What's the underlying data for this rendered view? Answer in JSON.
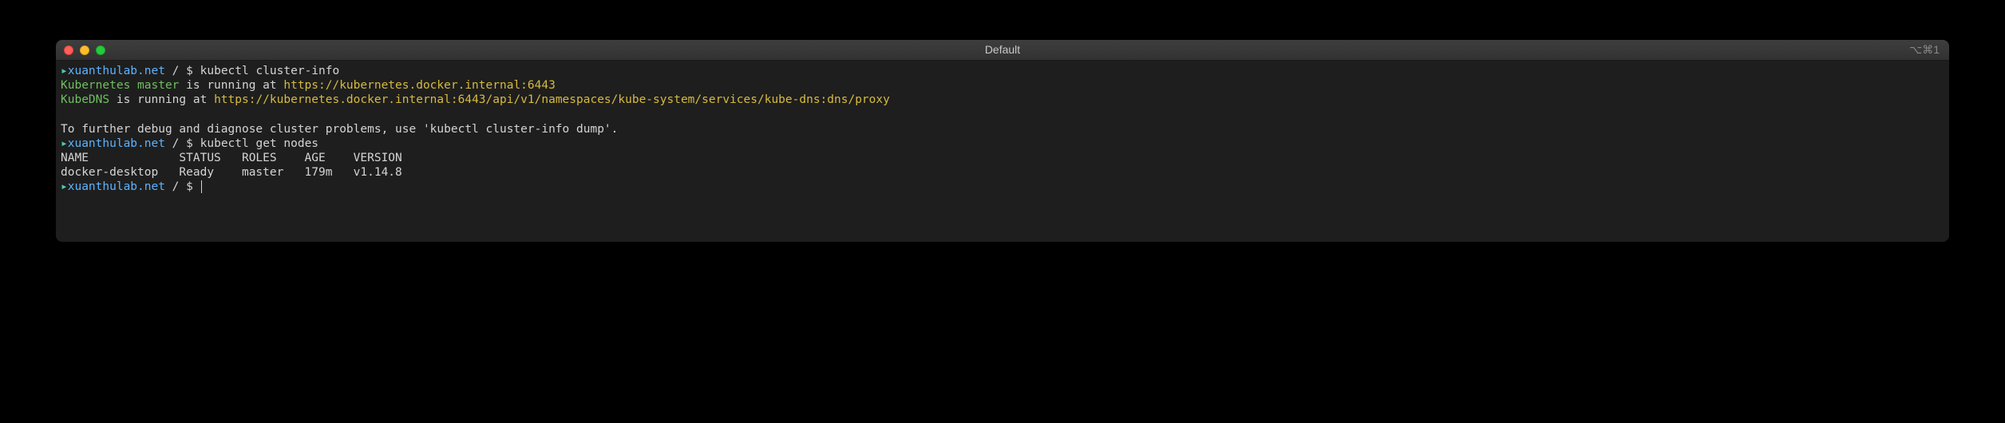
{
  "window": {
    "title": "Default",
    "shortcut": "⌥⌘1"
  },
  "prompt": {
    "arrow": "▸",
    "host": "xuanthulab.net",
    "sep": " / ",
    "dollar": "$ "
  },
  "lines": {
    "cmd1": "kubectl cluster-info",
    "master_label": "Kubernetes master",
    "running_at": " is running at ",
    "master_url": "https://kubernetes.docker.internal:6443",
    "kubedns_label": "KubeDNS",
    "kubedns_url": "https://kubernetes.docker.internal:6443/api/v1/namespaces/kube-system/services/kube-dns:dns/proxy",
    "debug_msg": "To further debug and diagnose cluster problems, use 'kubectl cluster-info dump'.",
    "cmd2": "kubectl get nodes",
    "table_header": "NAME             STATUS   ROLES    AGE    VERSION",
    "table_row1": "docker-desktop   Ready    master   179m   v1.14.8"
  },
  "nodes_table": {
    "headers": [
      "NAME",
      "STATUS",
      "ROLES",
      "AGE",
      "VERSION"
    ],
    "rows": [
      {
        "name": "docker-desktop",
        "status": "Ready",
        "roles": "master",
        "age": "179m",
        "version": "v1.14.8"
      }
    ]
  }
}
